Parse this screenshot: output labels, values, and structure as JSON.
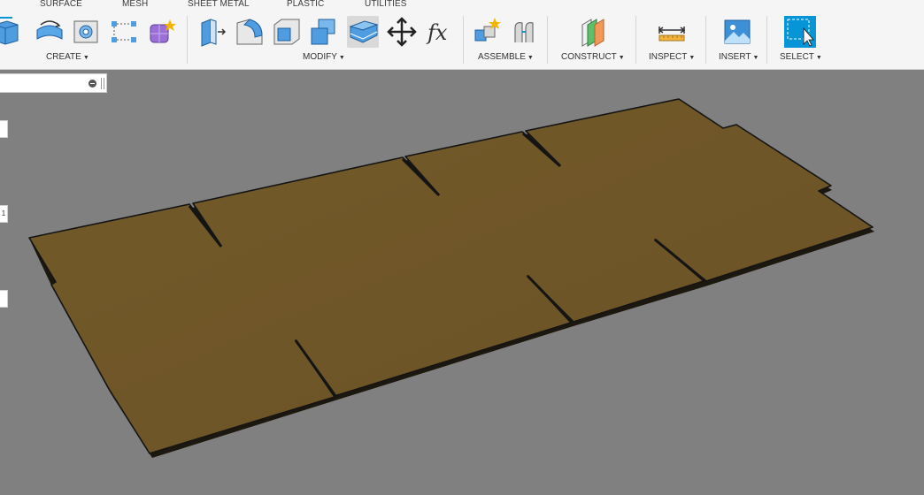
{
  "tabs": {
    "surface": "SURFACE",
    "mesh": "MESH",
    "sheet_metal": "SHEET METAL",
    "plastic": "PLASTIC",
    "utilities": "UTILITIES"
  },
  "groups": {
    "create": "CREATE",
    "modify": "MODIFY",
    "assemble": "ASSEMBLE",
    "construct": "CONSTRUCT",
    "inspect": "INSPECT",
    "insert": "INSERT",
    "select": "SELECT"
  },
  "caret": "▼",
  "side_tabs": {
    "middle_label": "1"
  },
  "colors": {
    "accent": "#0696d7",
    "sheet": "#6f5627",
    "viewport": "#808080",
    "toolbar": "#f5f5f5"
  }
}
